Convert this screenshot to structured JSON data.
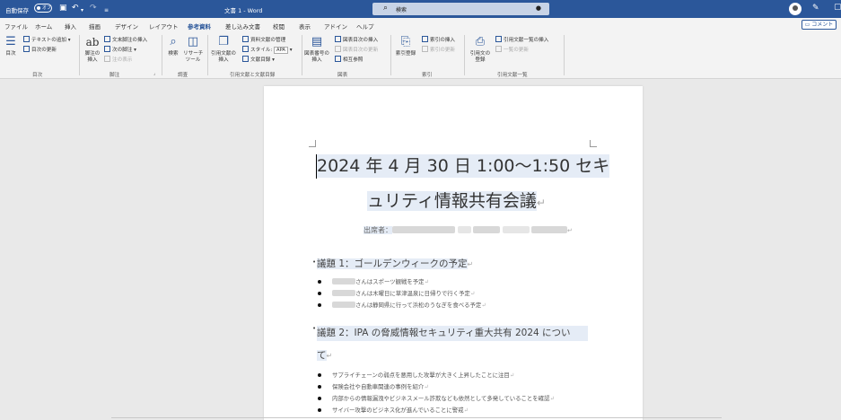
{
  "titlebar": {
    "autosave_label": "自動保存",
    "autosave_state": "オフ",
    "document_title": "文書 1  -  Word",
    "search_placeholder": "検索",
    "bg_color": "#2b579a"
  },
  "tabs": [
    {
      "label": "ファイル"
    },
    {
      "label": "ホーム"
    },
    {
      "label": "挿入"
    },
    {
      "label": "描画"
    },
    {
      "label": "デザイン"
    },
    {
      "label": "レイアウト"
    },
    {
      "label": "参考資料",
      "active": true
    },
    {
      "label": "差し込み文書"
    },
    {
      "label": "校閲"
    },
    {
      "label": "表示"
    },
    {
      "label": "アドイン"
    },
    {
      "label": "ヘルプ"
    }
  ],
  "comment_button": "コメント",
  "ribbon": {
    "toc": {
      "big": "目次",
      "add_text": "テキストの追加",
      "update_toc": "目次の更新",
      "group": "目次"
    },
    "footnotes": {
      "big": "脚注の\n挿入",
      "big_icon": "ab",
      "insert_endnote": "文末脚注の挿入",
      "next_footnote": "次の脚注",
      "show_notes": "注の表示",
      "group": "脚注"
    },
    "research": {
      "search": "検索",
      "researcher": "リサーチ\nツール",
      "group": "調査"
    },
    "citations": {
      "insert_citation": "引用文献の\n挿入",
      "manage_sources": "資料文献の管理",
      "style_label": "スタイル:",
      "style_value": "APA",
      "bibliography": "文献目録",
      "group": "引用文献と文献目録"
    },
    "captions": {
      "insert_caption": "図表番号の\n挿入",
      "insert_table_of_figures": "図表目次の挿入",
      "update_table": "図表目次の更新",
      "cross_reference": "相互参照",
      "group": "図表"
    },
    "index": {
      "mark_entry": "索引登録",
      "insert_index": "索引の挿入",
      "update_index": "索引の更新",
      "group": "索引"
    },
    "toa": {
      "mark_citation": "引用文の\n登録",
      "insert_toa": "引用文献一覧の挿入",
      "update_toa": "一覧の更新",
      "group": "引用文献一覧"
    }
  },
  "document": {
    "title_line1": "2024 年 4 月 30 日  1:00〜1:50  セキ",
    "title_line2": "ュリティ情報共有会議",
    "attendees_label": "出席者：",
    "agenda1_heading": "議題 1：ゴールデンウィークの予定",
    "agenda1_items": [
      "さんはスポーツ観戦を予定",
      "さんは木曜日に草津温泉に日帰りで行く予定",
      "さんは静岡県に行って浜松のうなぎを食べる予定"
    ],
    "agenda2_heading_line1": "議題 2：IPA の脅威情報セキュリティ重大共有 2024 につい",
    "agenda2_heading_line2": "て",
    "agenda2_items": [
      "サプライチェーンの弱点を悪用した攻撃が大きく上昇したことに注目",
      "保険会社や自動車関連の事例を紹介",
      "内部からの情報漏洩やビジネスメール詐欺なども依然として多発していることを確認",
      "サイバー攻撃のビジネス化が進んでいることに警戒"
    ]
  }
}
